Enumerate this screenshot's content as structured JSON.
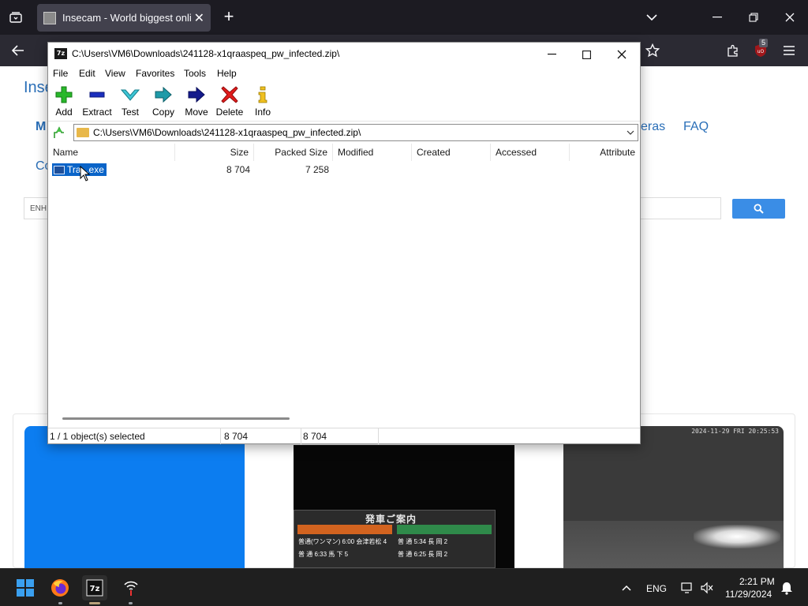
{
  "browser": {
    "tab_title": "Insecam - World biggest online",
    "ext_badge": "5"
  },
  "website": {
    "title": "Insecam",
    "title_visible": "Inse",
    "nav_m": "M",
    "nav_cameras_partial": "eras",
    "nav_faq": "FAQ",
    "co_partial": "Co",
    "search_label": "ENH",
    "cam2_board_title": "発車ご案内",
    "cam2_board_rows": [
      "普通(ワンマン) 6:00 会津若松 4",
      "普 通 6:33 馬 下 5",
      "普 通 5:34 長 岡 2",
      "普 通 6:25 長 岡 2"
    ],
    "cam3_stamp": "2024-11-29 FRI 20:25:53"
  },
  "sevenzip": {
    "window_title": "C:\\Users\\VM6\\Downloads\\241128-x1qraaspeq_pw_infected.zip\\",
    "logo": "7z",
    "menu": [
      "File",
      "Edit",
      "View",
      "Favorites",
      "Tools",
      "Help"
    ],
    "toolbar": [
      "Add",
      "Extract",
      "Test",
      "Copy",
      "Move",
      "Delete",
      "Info"
    ],
    "address": "C:\\Users\\VM6\\Downloads\\241128-x1qraaspeq_pw_infected.zip\\",
    "columns": [
      "Name",
      "Size",
      "Packed Size",
      "Modified",
      "Created",
      "Accessed",
      "Attribute"
    ],
    "files": [
      {
        "name": "Tra...exe",
        "size": "8 704",
        "packed_size": "7 258",
        "modified": "",
        "created": "",
        "accessed": "",
        "attributes": ""
      }
    ],
    "status": {
      "selected": "1 / 1 object(s) selected",
      "size": "8 704",
      "packed": "8 704"
    }
  },
  "taskbar": {
    "language": "ENG",
    "time": "2:21 PM",
    "date": "11/29/2024"
  },
  "colors": {
    "selection": "#0a64c8",
    "browser_bg": "#1c1b22",
    "add_green": "#28b82a",
    "delete_red": "#e21c1c",
    "link_blue": "#2a6fb8"
  }
}
